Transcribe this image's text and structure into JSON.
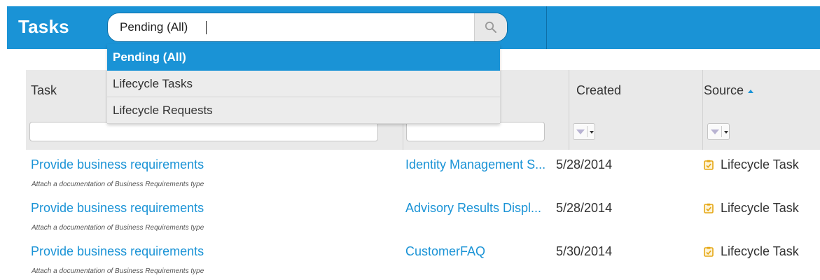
{
  "header": {
    "title": "Tasks",
    "search": {
      "value": "Pending (All)",
      "placeholder": ""
    },
    "search_icon": "search-icon"
  },
  "dropdown": {
    "options": [
      {
        "label": "Pending (All)",
        "selected": true
      },
      {
        "label": "Lifecycle Tasks",
        "selected": false
      },
      {
        "label": "Lifecycle Requests",
        "selected": false
      }
    ]
  },
  "table": {
    "columns": [
      {
        "label": "Task"
      },
      {
        "label": ""
      },
      {
        "label": "Created"
      },
      {
        "label": "Source",
        "sorted": "ascending"
      }
    ],
    "rows": [
      {
        "task": "Provide business requirements",
        "description": "Attach a documentation of Business Requirements type",
        "artifact": "Identity Management S...",
        "created": "5/28/2014",
        "source": "Lifecycle Task",
        "source_icon": "task-checkbox-icon"
      },
      {
        "task": "Provide business requirements",
        "description": "Attach a documentation of Business Requirements type",
        "artifact": "Advisory Results Displ...",
        "created": "5/28/2014",
        "source": "Lifecycle Task",
        "source_icon": "task-checkbox-icon"
      },
      {
        "task": "Provide business requirements",
        "description": "Attach a documentation of Business Requirements type",
        "artifact": "CustomerFAQ",
        "created": "5/30/2014",
        "source": "Lifecycle Task",
        "source_icon": "task-checkbox-icon"
      }
    ]
  },
  "colors": {
    "accent": "#1a93d6",
    "header_bg": "#e9e9e9",
    "link": "#1a93d6",
    "source_icon": "#e6a817"
  }
}
